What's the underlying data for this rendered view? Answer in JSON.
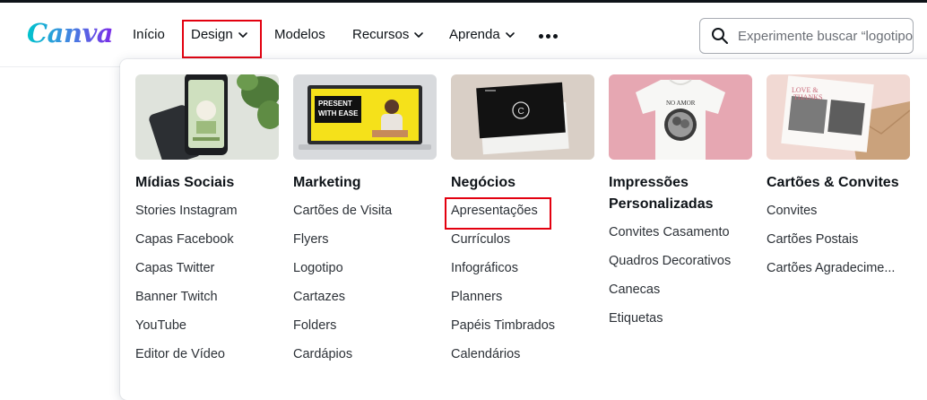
{
  "brand": {
    "logo_text": "Canva"
  },
  "nav": {
    "items": [
      {
        "label": "Início"
      },
      {
        "label": "Design"
      },
      {
        "label": "Modelos"
      },
      {
        "label": "Recursos"
      },
      {
        "label": "Aprenda"
      }
    ],
    "more_icon": "more-horizontal-icon"
  },
  "search": {
    "placeholder": "Experimente buscar “logotipo”",
    "icon": "search-icon"
  },
  "colors": {
    "highlight": "#e3000f",
    "logo_gradient": [
      "#00c4cc",
      "#7d2ae8"
    ]
  },
  "design_menu": {
    "columns": [
      {
        "title": "Mídias Sociais",
        "thumbnail": "phone-social-post-thumbnail",
        "links": [
          "Stories Instagram",
          "Capas Facebook",
          "Capas Twitter",
          "Banner Twitch",
          "YouTube",
          "Editor de Vídeo"
        ]
      },
      {
        "title": "Marketing",
        "thumbnail": "laptop-presentation-thumbnail",
        "thumbnail_text": "PRESENT WITH EASE",
        "links": [
          "Cartões de Visita",
          "Flyers",
          "Logotipo",
          "Cartazes",
          "Folders",
          "Cardápios"
        ]
      },
      {
        "title": "Negócios",
        "thumbnail": "business-card-thumbnail",
        "links": [
          "Apresentações",
          "Currículos",
          "Infográficos",
          "Planners",
          "Papéis Timbrados",
          "Calendários"
        ]
      },
      {
        "title": "Impressões Personalizadas",
        "thumbnail": "custom-tshirt-thumbnail",
        "links": [
          "Convites Casamento",
          "Quadros Decorativos",
          "Canecas",
          "Etiquetas"
        ]
      },
      {
        "title": "Cartões & Convites",
        "thumbnail": "greeting-card-thumbnail",
        "thumbnail_text": "LOVE & THANKS",
        "links": [
          "Convites",
          "Cartões Postais",
          "Cartões Agradecime..."
        ]
      }
    ]
  }
}
